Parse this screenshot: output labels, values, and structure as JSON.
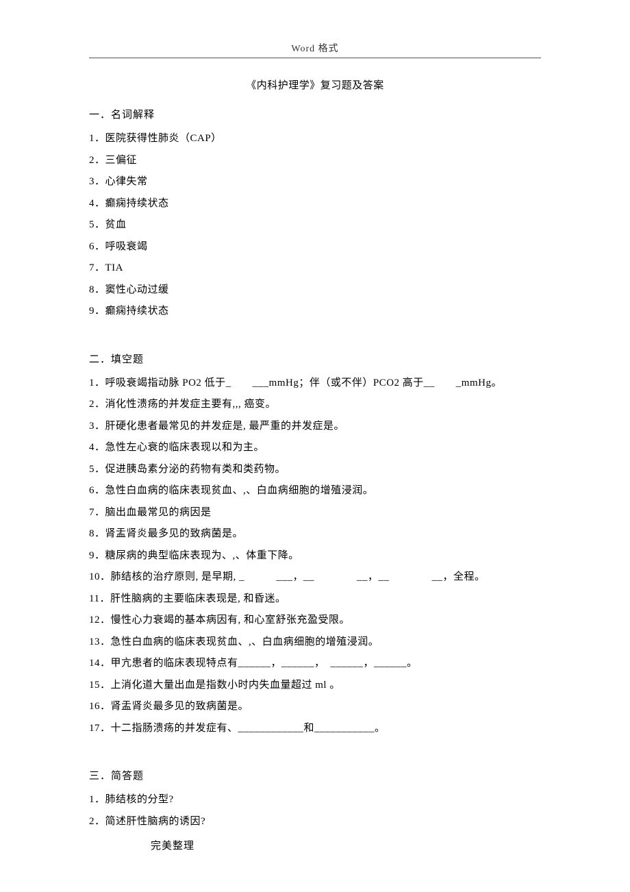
{
  "header": "Word 格式",
  "title": "《内科护理学》复习题及答案",
  "sections": {
    "s1": {
      "heading": "一．名词解释",
      "items": [
        "1．医院获得性肺炎（CAP）",
        "2．三偏征",
        "3．心律失常",
        "4．癫痫持续状态",
        "5．贫血",
        "6．呼吸衰竭",
        "7．TIA",
        "8．窦性心动过缓",
        "9．癫痫持续状态"
      ]
    },
    "s2": {
      "heading": "二．填空题",
      "items": [
        "1．呼吸衰竭指动脉 PO2 低于_　　___mmHg；伴（或不伴）PCO2 高于__　　_mmHg。",
        "2．消化性溃疡的并发症主要有,,, 癌变。",
        "3．肝硬化患者最常见的并发症是, 最严重的并发症是。",
        "4．急性左心衰的临床表现以和为主。",
        "5．促进胰岛素分泌的药物有类和类药物。",
        "6．急性白血病的临床表现贫血、,、白血病细胞的增殖浸润。",
        "7．脑出血最常见的病因是",
        "8．肾盂肾炎最多见的致病菌是。",
        "9．糖尿病的典型临床表现为、,、体重下降。",
        "10．肺结核的治疗原则, 是早期, _　　　___，__　　　　__，__　　　　__，全程。",
        "11．肝性脑病的主要临床表现是, 和昏迷。",
        "12．慢性心力衰竭的基本病因有, 和心室舒张充盈受限。",
        "13．急性白血病的临床表现贫血、,、白血病细胞的增殖浸润。",
        "14．甲亢患者的临床表现特点有______，______，　______，______。",
        "15．上消化道大量出血是指数小时内失血量超过 ml 。",
        "16．肾盂肾炎最多见的致病菌是。",
        "17．十二指肠溃疡的并发症有、____________和___________。"
      ]
    },
    "s3": {
      "heading": "三．简答题",
      "items": [
        "1．肺结核的分型?",
        "2．简述肝性脑病的诱因?"
      ]
    }
  },
  "footer": "完美整理"
}
